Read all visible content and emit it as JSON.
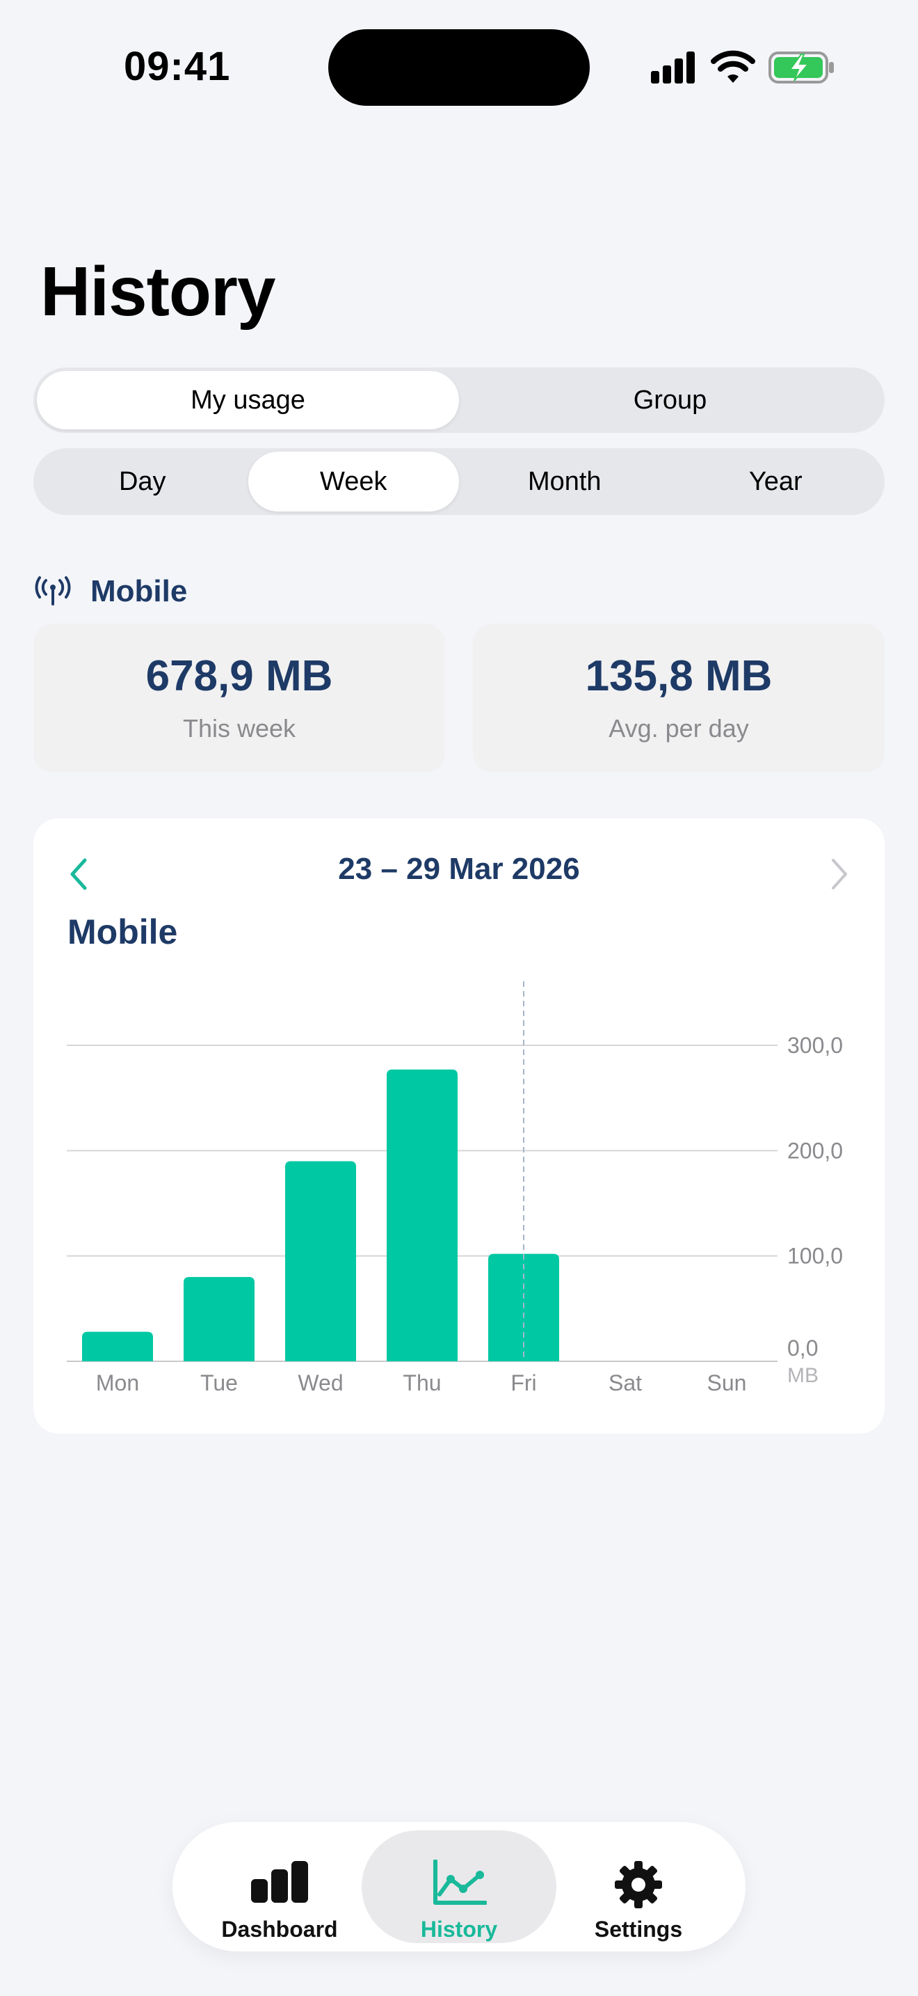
{
  "status_bar": {
    "time": "09:41"
  },
  "page": {
    "title": "History"
  },
  "mode_tabs": [
    {
      "label": "My usage",
      "active": true
    },
    {
      "label": "Group",
      "active": false
    }
  ],
  "period_tabs": [
    {
      "label": "Day",
      "active": false
    },
    {
      "label": "Week",
      "active": true
    },
    {
      "label": "Month",
      "active": false
    },
    {
      "label": "Year",
      "active": false
    }
  ],
  "section": {
    "title": "Mobile",
    "icon": "antenna-icon"
  },
  "stats": {
    "total_value": "678,9 MB",
    "total_label": "This week",
    "avg_value": "135,8 MB",
    "avg_label": "Avg. per day"
  },
  "chart_card": {
    "date_range": "23 – 29 Mar 2026",
    "title": "Mobile"
  },
  "chart_data": {
    "type": "bar",
    "categories": [
      "Mon",
      "Tue",
      "Wed",
      "Thu",
      "Fri",
      "Sat",
      "Sun"
    ],
    "values": [
      28,
      80,
      190,
      277,
      102,
      0,
      0
    ],
    "ylim": [
      0,
      300
    ],
    "yticks": [
      "0,0",
      "100,0",
      "200,0",
      "300,0"
    ],
    "yunit": "MB",
    "highlight_category": "Fri",
    "grid": true,
    "bar_color": "#00c8a3"
  },
  "tab_bar": {
    "tabs": [
      {
        "label": "Dashboard",
        "icon": "bar-chart-icon",
        "active": false
      },
      {
        "label": "History",
        "icon": "line-chart-icon",
        "active": true
      },
      {
        "label": "Settings",
        "icon": "gear-icon",
        "active": false
      }
    ]
  },
  "colors": {
    "accent": "#00c8a3",
    "navy": "#1e3a66",
    "battery": "#34c759"
  }
}
